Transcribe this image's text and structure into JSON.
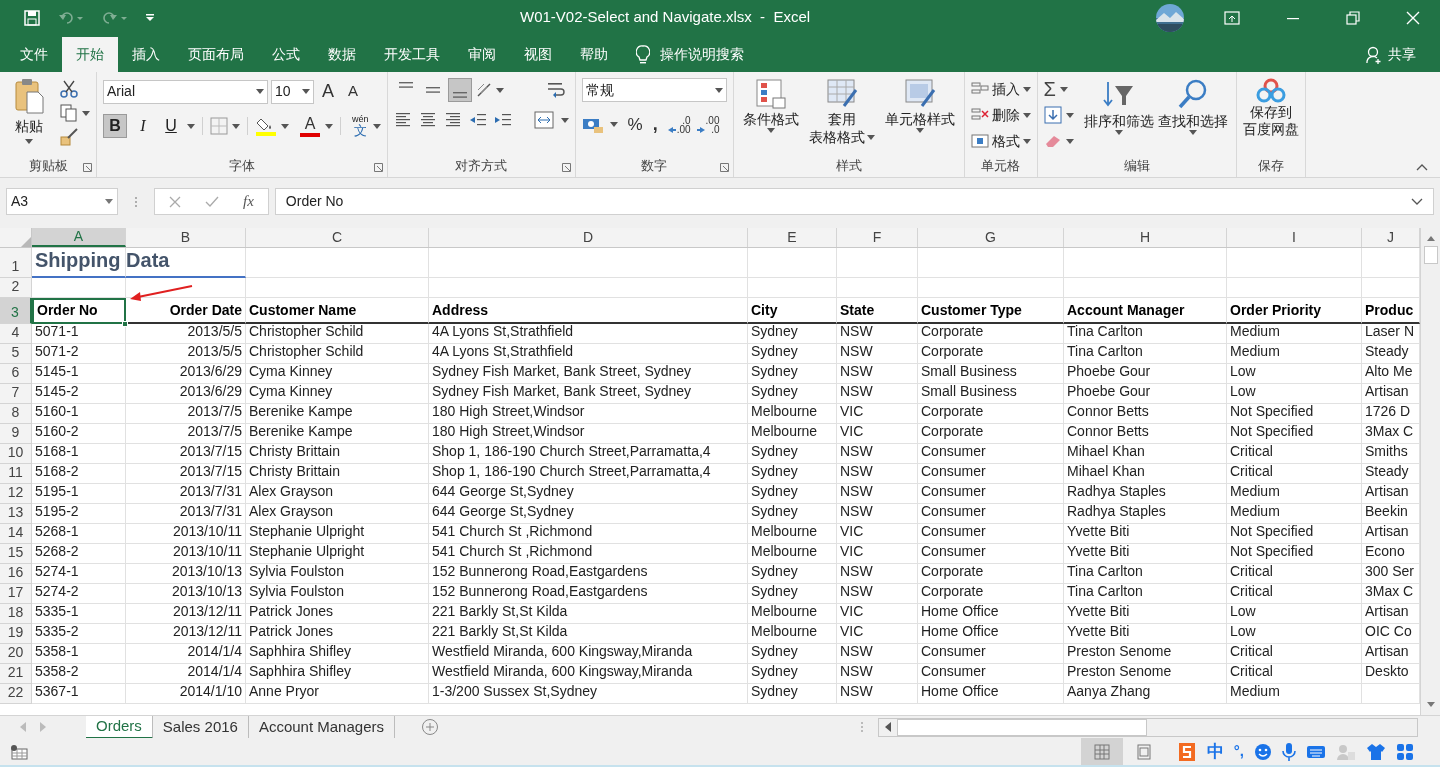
{
  "title_bar": {
    "title": "W01-V02-Select and Navigate.xlsx  -  Excel"
  },
  "menu_tabs": [
    {
      "label": "文件",
      "selected": false
    },
    {
      "label": "开始",
      "selected": true
    },
    {
      "label": "插入",
      "selected": false
    },
    {
      "label": "页面布局",
      "selected": false
    },
    {
      "label": "公式",
      "selected": false
    },
    {
      "label": "数据",
      "selected": false
    },
    {
      "label": "开发工具",
      "selected": false
    },
    {
      "label": "审阅",
      "selected": false
    },
    {
      "label": "视图",
      "selected": false
    },
    {
      "label": "帮助",
      "selected": false
    }
  ],
  "tell_me": "操作说明搜索",
  "share": "共享",
  "ribbon": {
    "clipboard": {
      "paste": "粘贴",
      "label": "剪贴板"
    },
    "font": {
      "font_name": "Arial",
      "font_size": "10",
      "grow": "A",
      "shrink": "A",
      "toggles": [
        {
          "kind": "bold",
          "label": "B",
          "selected": true
        },
        {
          "kind": "italic",
          "label": "I",
          "selected": false
        },
        {
          "kind": "underline",
          "label": "U",
          "selected": false
        }
      ],
      "font_color": "A",
      "phonetic": {
        "pinyin": "wén",
        "char": "文"
      },
      "label": "字体"
    },
    "alignment": {
      "vertical": [
        {
          "kind": "top",
          "selected": false
        },
        {
          "kind": "middle",
          "selected": false
        },
        {
          "kind": "bottom",
          "selected": true
        }
      ],
      "label": "对齐方式"
    },
    "number": {
      "format": "常规",
      "percent": "%",
      "comma": ",",
      "decimals": [
        {
          "kind": "increase",
          "lines": [
            ".0",
            ".00"
          ]
        },
        {
          "kind": "decrease",
          "lines": [
            ".00",
            ".0"
          ]
        }
      ],
      "label": "数字"
    },
    "styles": {
      "buttons": [
        {
          "kind": "conditional",
          "lines": [
            "条件格式"
          ]
        },
        {
          "kind": "table",
          "lines": [
            "套用",
            "表格格式"
          ]
        },
        {
          "kind": "cell",
          "lines": [
            "单元格样式"
          ]
        }
      ],
      "label": "样式"
    },
    "cells": {
      "buttons": [
        {
          "kind": "insert",
          "label": "插入"
        },
        {
          "kind": "delete",
          "label": "删除"
        },
        {
          "kind": "format",
          "label": "格式"
        }
      ],
      "label": "单元格"
    },
    "editing": {
      "autosum": "Σ",
      "buttons": [
        {
          "kind": "sort",
          "label": "排序和筛选"
        },
        {
          "kind": "find",
          "label": "查找和选择"
        }
      ],
      "label": "编辑"
    },
    "save": {
      "lines": [
        "保存到",
        "百度网盘"
      ],
      "label": "保存"
    }
  },
  "formula_bar": {
    "name_box": "A3",
    "function_label": "fx",
    "formula": "Order No"
  },
  "sheet": {
    "columns": [
      {
        "letter": "A",
        "kind": "text",
        "selected": true
      },
      {
        "letter": "B",
        "kind": "date",
        "selected": false
      },
      {
        "letter": "C",
        "kind": "text",
        "selected": false
      },
      {
        "letter": "D",
        "kind": "text",
        "selected": false
      },
      {
        "letter": "E",
        "kind": "text",
        "selected": false
      },
      {
        "letter": "F",
        "kind": "text",
        "selected": false
      },
      {
        "letter": "G",
        "kind": "text",
        "selected": false
      },
      {
        "letter": "H",
        "kind": "text",
        "selected": false
      },
      {
        "letter": "I",
        "kind": "text",
        "selected": false
      },
      {
        "letter": "J",
        "kind": "text",
        "selected": false
      }
    ],
    "rows": [
      {
        "number": "1",
        "kind": "title",
        "selected": false,
        "cells": [
          "Shipping Data"
        ]
      },
      {
        "number": "2",
        "kind": "blank",
        "selected": false
      },
      {
        "number": "3",
        "kind": "header",
        "selected": true,
        "cells": [
          "Order No",
          "Order Date",
          "Customer Name",
          "Address",
          "City",
          "State",
          "Customer Type",
          "Account Manager",
          "Order Priority",
          "Produc"
        ]
      },
      {
        "number": "4",
        "kind": "data",
        "selected": false,
        "cells": [
          "5071-1",
          "2013/5/5",
          "Christopher Schild",
          "4A Lyons St,Strathfield",
          "Sydney",
          "NSW",
          "Corporate",
          "Tina Carlton",
          "Medium",
          "Laser N"
        ]
      },
      {
        "number": "5",
        "kind": "data",
        "selected": false,
        "cells": [
          "5071-2",
          "2013/5/5",
          "Christopher Schild",
          "4A Lyons St,Strathfield",
          "Sydney",
          "NSW",
          "Corporate",
          "Tina Carlton",
          "Medium",
          "Steady"
        ]
      },
      {
        "number": "6",
        "kind": "data",
        "selected": false,
        "cells": [
          "5145-1",
          "2013/6/29",
          "Cyma Kinney",
          "Sydney Fish Market, Bank Street, Sydney",
          "Sydney",
          "NSW",
          "Small Business",
          "Phoebe Gour",
          "Low",
          "Alto Me"
        ]
      },
      {
        "number": "7",
        "kind": "data",
        "selected": false,
        "cells": [
          "5145-2",
          "2013/6/29",
          "Cyma Kinney",
          "Sydney Fish Market, Bank Street, Sydney",
          "Sydney",
          "NSW",
          "Small Business",
          "Phoebe Gour",
          "Low",
          "Artisan"
        ]
      },
      {
        "number": "8",
        "kind": "data",
        "selected": false,
        "cells": [
          "5160-1",
          "2013/7/5",
          "Berenike Kampe",
          "180 High Street,Windsor",
          "Melbourne",
          "VIC",
          "Corporate",
          "Connor Betts",
          "Not Specified",
          "1726 D"
        ]
      },
      {
        "number": "9",
        "kind": "data",
        "selected": false,
        "cells": [
          "5160-2",
          "2013/7/5",
          "Berenike Kampe",
          "180 High Street,Windsor",
          "Melbourne",
          "VIC",
          "Corporate",
          "Connor Betts",
          "Not Specified",
          "3Max C"
        ]
      },
      {
        "number": "10",
        "kind": "data",
        "selected": false,
        "cells": [
          "5168-1",
          "2013/7/15",
          "Christy Brittain",
          "Shop 1, 186-190 Church Street,Parramatta,4",
          "Sydney",
          "NSW",
          "Consumer",
          "Mihael Khan",
          "Critical",
          "Smiths"
        ]
      },
      {
        "number": "11",
        "kind": "data",
        "selected": false,
        "cells": [
          "5168-2",
          "2013/7/15",
          "Christy Brittain",
          "Shop 1, 186-190 Church Street,Parramatta,4",
          "Sydney",
          "NSW",
          "Consumer",
          "Mihael Khan",
          "Critical",
          "Steady"
        ]
      },
      {
        "number": "12",
        "kind": "data",
        "selected": false,
        "cells": [
          "5195-1",
          "2013/7/31",
          "Alex Grayson",
          "644 George St,Sydney",
          "Sydney",
          "NSW",
          "Consumer",
          "Radhya Staples",
          "Medium",
          "Artisan"
        ]
      },
      {
        "number": "13",
        "kind": "data",
        "selected": false,
        "cells": [
          "5195-2",
          "2013/7/31",
          "Alex Grayson",
          "644 George St,Sydney",
          "Sydney",
          "NSW",
          "Consumer",
          "Radhya Staples",
          "Medium",
          "Beekin"
        ]
      },
      {
        "number": "14",
        "kind": "data",
        "selected": false,
        "cells": [
          "5268-1",
          "2013/10/11",
          "Stephanie Ulpright",
          "541 Church St ,Richmond",
          "Melbourne",
          "VIC",
          "Consumer",
          "Yvette Biti",
          "Not Specified",
          "Artisan"
        ]
      },
      {
        "number": "15",
        "kind": "data",
        "selected": false,
        "cells": [
          "5268-2",
          "2013/10/11",
          "Stephanie Ulpright",
          "541 Church St ,Richmond",
          "Melbourne",
          "VIC",
          "Consumer",
          "Yvette Biti",
          "Not Specified",
          "Econo"
        ]
      },
      {
        "number": "16",
        "kind": "data",
        "selected": false,
        "cells": [
          "5274-1",
          "2013/10/13",
          "Sylvia Foulston",
          "152 Bunnerong Road,Eastgardens",
          "Sydney",
          "NSW",
          "Corporate",
          "Tina Carlton",
          "Critical",
          "300 Ser"
        ]
      },
      {
        "number": "17",
        "kind": "data",
        "selected": false,
        "cells": [
          "5274-2",
          "2013/10/13",
          "Sylvia Foulston",
          "152 Bunnerong Road,Eastgardens",
          "Sydney",
          "NSW",
          "Corporate",
          "Tina Carlton",
          "Critical",
          "3Max C"
        ]
      },
      {
        "number": "18",
        "kind": "data",
        "selected": false,
        "cells": [
          "5335-1",
          "2013/12/11",
          "Patrick Jones",
          "221 Barkly St,St Kilda",
          "Melbourne",
          "VIC",
          "Home Office",
          "Yvette Biti",
          "Low",
          "Artisan"
        ]
      },
      {
        "number": "19",
        "kind": "data",
        "selected": false,
        "cells": [
          "5335-2",
          "2013/12/11",
          "Patrick Jones",
          "221 Barkly St,St Kilda",
          "Melbourne",
          "VIC",
          "Home Office",
          "Yvette Biti",
          "Low",
          "OIC Co"
        ]
      },
      {
        "number": "20",
        "kind": "data",
        "selected": false,
        "cells": [
          "5358-1",
          "2014/1/4",
          "Saphhira Shifley",
          "Westfield Miranda, 600 Kingsway,Miranda",
          "Sydney",
          "NSW",
          "Consumer",
          "Preston Senome",
          "Critical",
          "Artisan"
        ]
      },
      {
        "number": "21",
        "kind": "data",
        "selected": false,
        "cells": [
          "5358-2",
          "2014/1/4",
          "Saphhira Shifley",
          "Westfield Miranda, 600 Kingsway,Miranda",
          "Sydney",
          "NSW",
          "Consumer",
          "Preston Senome",
          "Critical",
          "Deskto"
        ]
      },
      {
        "number": "22",
        "kind": "data",
        "selected": false,
        "cells": [
          "5367-1",
          "2014/1/10",
          "Anne Pryor",
          "1-3/200 Sussex St,Sydney",
          "Sydney",
          "NSW",
          "Home Office",
          "Aanya Zhang",
          "Medium"
        ]
      }
    ]
  },
  "sheet_tabs": [
    {
      "label": "Orders",
      "selected": true
    },
    {
      "label": "Sales 2016",
      "selected": false
    },
    {
      "label": "Account Managers",
      "selected": false
    }
  ],
  "status_bar": {
    "views": [
      {
        "kind": "normal",
        "selected": true
      },
      {
        "kind": "page_layout",
        "selected": false
      }
    ]
  },
  "ime": {
    "mode": "中",
    "punctuation": "°,"
  }
}
